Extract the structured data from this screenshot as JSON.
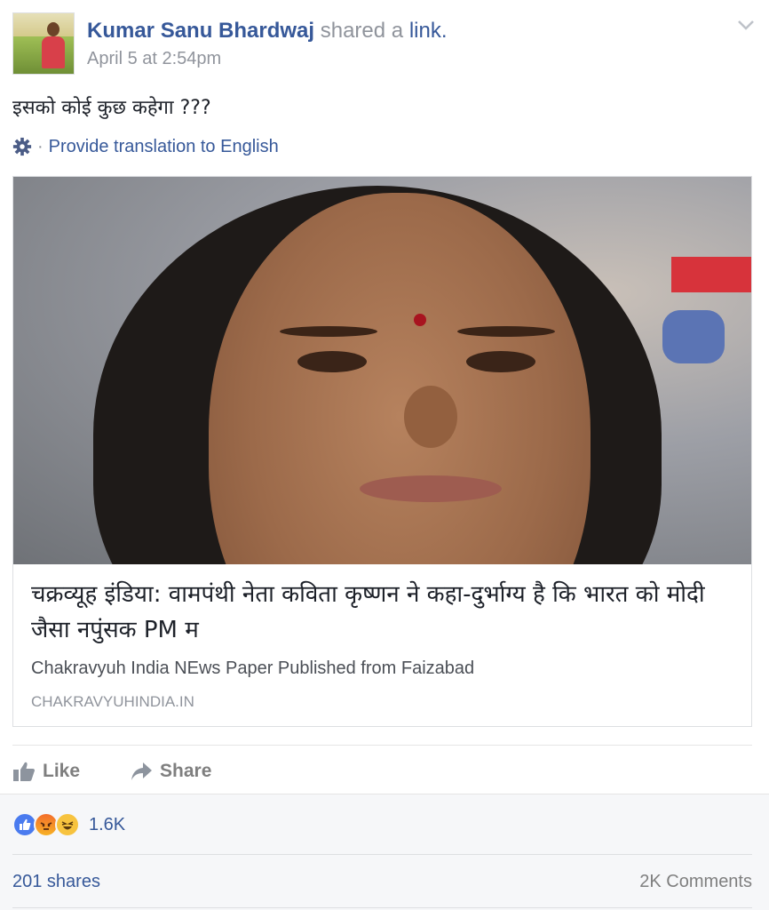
{
  "post": {
    "author": "Kumar Sanu Bhardwaj",
    "shared_text": "shared a",
    "link_word": "link.",
    "timestamp": "April 5 at 2:54pm",
    "text": "इसको कोई कुछ कहेगा ???",
    "translate_label": "Provide translation to English",
    "dot": "·"
  },
  "link_card": {
    "title": "चक्रव्यूह इंडिया: वामपंथी नेता कविता कृष्णन ने कहा-दुर्भाग्य है कि भारत को मोदी जैसा नपुंसक PM म",
    "description": "Chakravyuh India NEws Paper Published from Faizabad",
    "domain": "CHAKRAVYUHINDIA.IN"
  },
  "actions": {
    "like_label": "Like",
    "share_label": "Share"
  },
  "reactions": {
    "count": "1.6K",
    "types": [
      "like",
      "angry",
      "haha"
    ]
  },
  "stats": {
    "shares": "201 shares",
    "comments": "2K Comments"
  },
  "colors": {
    "link_blue": "#365899",
    "muted_gray": "#90949c",
    "text_dark": "#1d2129"
  },
  "icons": [
    "chevron-down-icon",
    "gear-icon",
    "like-icon",
    "share-icon",
    "like-reaction-icon",
    "angry-reaction-icon",
    "haha-reaction-icon"
  ]
}
